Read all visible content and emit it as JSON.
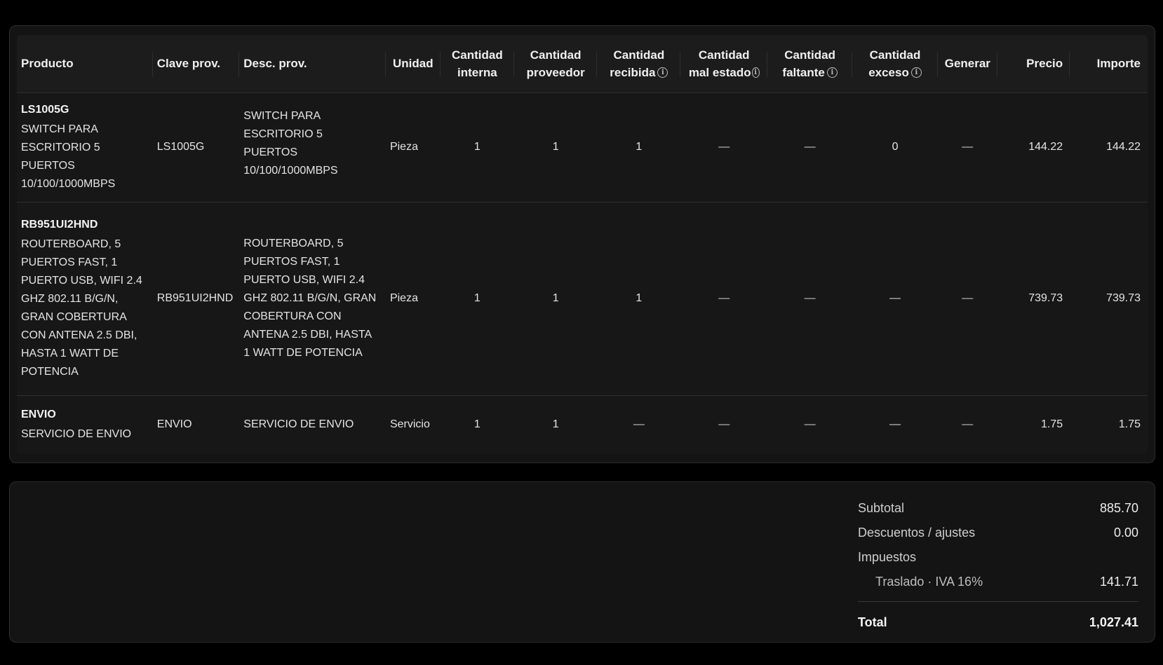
{
  "columns": {
    "producto": "Producto",
    "clave_prov": "Clave prov.",
    "desc_prov": "Desc. prov.",
    "unidad": "Unidad",
    "cant_interna_1": "Cantidad",
    "cant_interna_2": "interna",
    "cant_proveedor_1": "Cantidad",
    "cant_proveedor_2": "proveedor",
    "cant_recibida_1": "Cantidad",
    "cant_recibida_2": "recibida",
    "cant_mal_estado_1": "Cantidad",
    "cant_mal_estado_2": "mal estado",
    "cant_faltante_1": "Cantidad",
    "cant_faltante_2": "faltante",
    "cant_exceso_1": "Cantidad",
    "cant_exceso_2": "exceso",
    "generar": "Generar",
    "precio": "Precio",
    "importe": "Importe",
    "info_icon": "info-icon"
  },
  "rows": [
    {
      "code": "LS1005G",
      "description": "SWITCH PARA ESCRITORIO 5 PUERTOS 10/100/1000MBPS",
      "clave_prov": "LS1005G",
      "desc_prov": "SWITCH PARA ESCRITORIO 5 PUERTOS 10/100/1000MBPS",
      "unidad": "Pieza",
      "cant_interna": "1",
      "cant_proveedor": "1",
      "cant_recibida": "1",
      "cant_mal_estado": "—",
      "cant_faltante": "—",
      "cant_exceso": "0",
      "generar": "—",
      "precio": "144.22",
      "importe": "144.22"
    },
    {
      "code": "RB951UI2HND",
      "description": "ROUTERBOARD, 5 PUERTOS FAST, 1 PUERTO USB, WIFI 2.4 GHZ 802.11 B/G/N, GRAN COBERTURA CON ANTENA 2.5 DBI, HASTA 1 WATT DE POTENCIA",
      "clave_prov": "RB951UI2HND",
      "desc_prov": "ROUTERBOARD, 5 PUERTOS FAST, 1 PUERTO USB, WIFI 2.4 GHZ 802.11 B/G/N, GRAN COBERTURA CON ANTENA 2.5 DBI, HASTA 1 WATT DE POTENCIA",
      "unidad": "Pieza",
      "cant_interna": "1",
      "cant_proveedor": "1",
      "cant_recibida": "1",
      "cant_mal_estado": "—",
      "cant_faltante": "—",
      "cant_exceso": "—",
      "generar": "—",
      "precio": "739.73",
      "importe": "739.73"
    },
    {
      "code": "ENVIO",
      "description": "SERVICIO DE ENVIO",
      "clave_prov": "ENVIO",
      "desc_prov": "SERVICIO DE ENVIO",
      "unidad": "Servicio",
      "cant_interna": "1",
      "cant_proveedor": "1",
      "cant_recibida": "—",
      "cant_mal_estado": "—",
      "cant_faltante": "—",
      "cant_exceso": "—",
      "generar": "—",
      "precio": "1.75",
      "importe": "1.75"
    }
  ],
  "totals": {
    "subtotal_label": "Subtotal",
    "subtotal_value": "885.70",
    "descuentos_label": "Descuentos / ajustes",
    "descuentos_value": "0.00",
    "impuestos_label": "Impuestos",
    "traslado_label": "Traslado · IVA 16%",
    "traslado_value": "141.71",
    "total_label": "Total",
    "total_value": "1,027.41"
  }
}
